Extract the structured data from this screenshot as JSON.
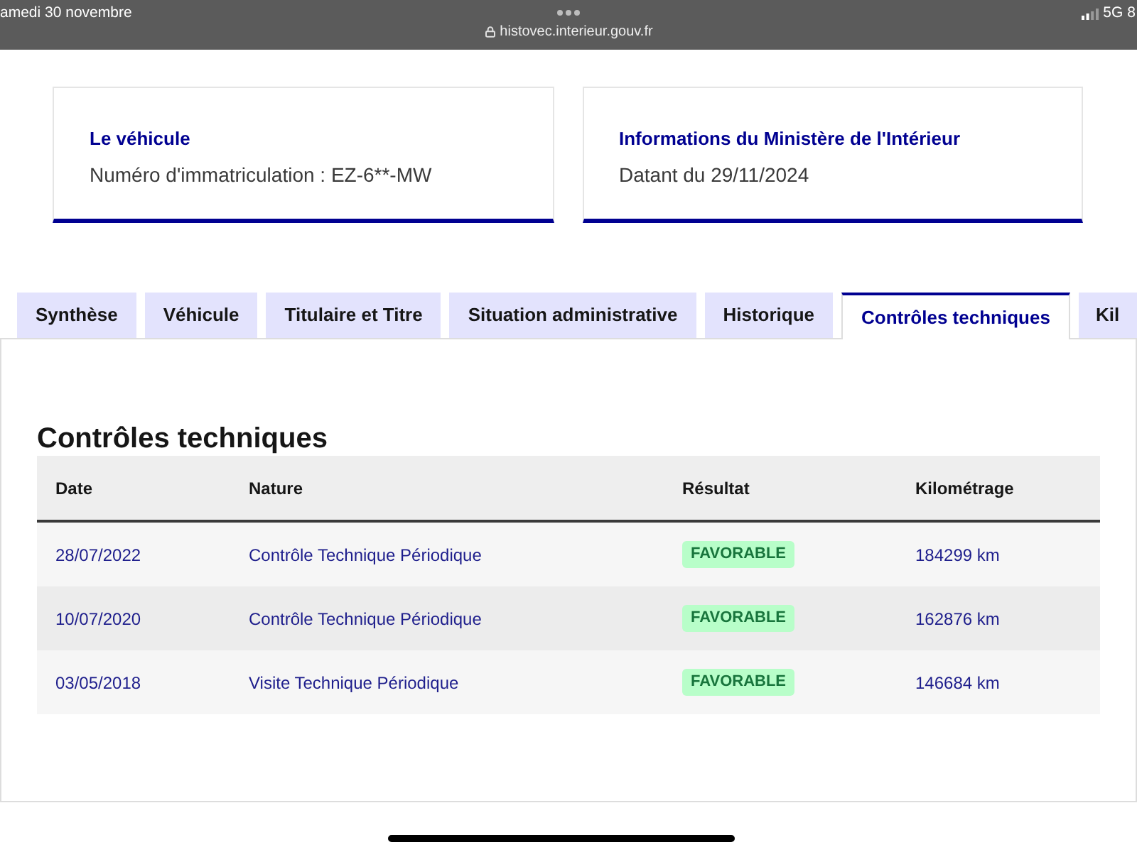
{
  "status_bar": {
    "date": "amedi 30 novembre",
    "url": "histovec.interieur.gouv.fr",
    "network": "5G",
    "battery": "8"
  },
  "cards": [
    {
      "title": "Le véhicule",
      "text": "Numéro d'immatriculation : EZ-6**-MW"
    },
    {
      "title": "Informations du Ministère de l'Intérieur",
      "text": "Datant du 29/11/2024"
    }
  ],
  "tabs": [
    {
      "label": "Synthèse",
      "selected": false
    },
    {
      "label": "Véhicule",
      "selected": false
    },
    {
      "label": "Titulaire et Titre",
      "selected": false
    },
    {
      "label": "Situation administrative",
      "selected": false
    },
    {
      "label": "Historique",
      "selected": false
    },
    {
      "label": "Contrôles techniques",
      "selected": true
    },
    {
      "label": "Kil",
      "selected": false
    }
  ],
  "section": {
    "title": "Contrôles techniques",
    "table": {
      "columns": [
        "Date",
        "Nature",
        "Résultat",
        "Kilométrage"
      ],
      "rows": [
        {
          "date": "28/07/2022",
          "nature": "Contrôle Technique Périodique",
          "result": "FAVORABLE",
          "mileage": "184299 km"
        },
        {
          "date": "10/07/2020",
          "nature": "Contrôle Technique Périodique",
          "result": "FAVORABLE",
          "mileage": "162876 km"
        },
        {
          "date": "03/05/2018",
          "nature": "Visite Technique Périodique",
          "result": "FAVORABLE",
          "mileage": "146684 km"
        }
      ]
    }
  }
}
